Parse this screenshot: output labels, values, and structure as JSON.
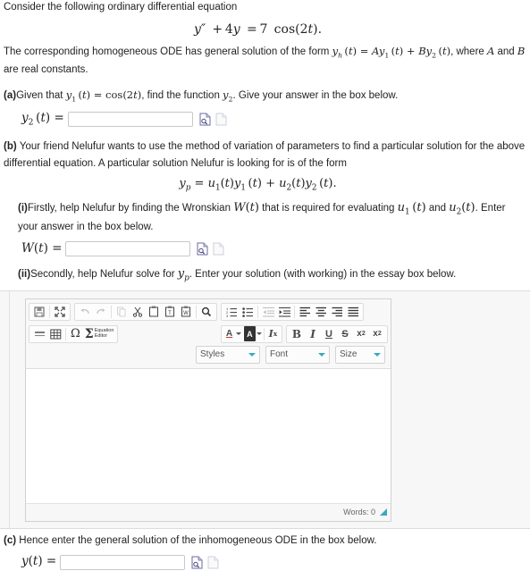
{
  "intro": {
    "line1": "Consider the following ordinary differential equation",
    "equation": "y'' + 4y = 7 cos(2t).",
    "line2_pre": "The corresponding homogeneous ODE has general solution of the form ",
    "line2_math": "y_h(t) = Ay_1(t) + By_2(t)",
    "line2_post": ", where A and B",
    "line3": "are real constants."
  },
  "part_a": {
    "label": "(a)",
    "text_pre": "Given that ",
    "given_math": "y_1(t) = cos(2t)",
    "text_mid": ", find the function ",
    "target_math": "y_2",
    "text_post": ". Give your answer in the box below.",
    "answer_label": "y_2(t) =",
    "input_value": "",
    "input_placeholder": ""
  },
  "part_b": {
    "label": "(b)",
    "text1": "Your friend Nelufur wants to use the method of variation of parameters to find a particular solution for the above",
    "text2": "differential equation. A particular solution Nelufur is looking for is of the form",
    "equation": "y_p = u_1(t)y_1(t) + u_2(t)y_2(t).",
    "sub_i": {
      "label": "(i)",
      "text_pre": "Firstly, help Nelufur by finding the Wronskian ",
      "math1": "W(t)",
      "text_mid": " that is required for evaluating ",
      "math2": "u_1(t)",
      "text_and": " and ",
      "math3": "u_2(t)",
      "text_post": ". Enter",
      "text_line2": "your answer in the box below.",
      "answer_label": "W(t) =",
      "input_value": "",
      "input_placeholder": ""
    },
    "sub_ii": {
      "label": "(ii)",
      "text_pre": "Secondly, help Nelufur solve for ",
      "math1": "y_p",
      "text_post": ". Enter your solution (with working) in the essay box below."
    }
  },
  "editor": {
    "toolbar_row1": [
      {
        "name": "save-icon",
        "glyph": "▤",
        "title": "Save",
        "disabled": false
      },
      {
        "name": "maximize-icon",
        "glyph": "⤢",
        "title": "Maximize",
        "disabled": false
      },
      {
        "name": "undo-icon",
        "glyph": "↶",
        "title": "Undo",
        "disabled": true
      },
      {
        "name": "redo-icon",
        "glyph": "↷",
        "title": "Redo",
        "disabled": true
      },
      {
        "name": "copy-icon",
        "glyph": "❐",
        "title": "Copy",
        "disabled": true
      },
      {
        "name": "cut-icon",
        "glyph": "✂",
        "title": "Cut",
        "disabled": false
      },
      {
        "name": "paste-icon",
        "glyph": "Ὄb",
        "title": "Paste",
        "disabled": false
      },
      {
        "name": "paste-text-icon",
        "glyph": "Ὄb",
        "title": "Paste as plain text",
        "disabled": false
      },
      {
        "name": "paste-word-icon",
        "glyph": "Ὄb",
        "title": "Paste from Word",
        "disabled": false
      },
      {
        "name": "search-icon",
        "glyph": "ὐd",
        "title": "Find",
        "disabled": false
      },
      {
        "name": "numbered-list-icon",
        "glyph": "≣",
        "title": "Insert/Remove Numbered List",
        "disabled": false
      },
      {
        "name": "bulleted-list-icon",
        "glyph": "≣",
        "title": "Insert/Remove Bulleted List",
        "disabled": false
      },
      {
        "name": "outdent-icon",
        "glyph": "⇤",
        "title": "Decrease Indent",
        "disabled": true
      },
      {
        "name": "indent-icon",
        "glyph": "⇥",
        "title": "Increase Indent",
        "disabled": false
      },
      {
        "name": "align-left-icon",
        "glyph": "≡",
        "title": "Align Left",
        "disabled": false
      },
      {
        "name": "align-center-icon",
        "glyph": "≡",
        "title": "Center",
        "disabled": false
      },
      {
        "name": "align-right-icon",
        "glyph": "≡",
        "title": "Align Right",
        "disabled": false
      },
      {
        "name": "justify-icon",
        "glyph": "≡",
        "title": "Justify",
        "disabled": false
      }
    ],
    "toolbar_row2_left": [
      {
        "name": "horizontal-rule-icon",
        "glyph": "—",
        "title": "Insert Horizontal Line"
      },
      {
        "name": "table-icon",
        "glyph": "⊞",
        "title": "Table"
      },
      {
        "name": "special-char-icon",
        "glyph": "Ω",
        "title": "Insert Special Character"
      }
    ],
    "equation_editor": {
      "sigma": "Σ",
      "line1": "Equation",
      "line2": "Editor"
    },
    "toolbar_row2_right_colors": [
      {
        "name": "text-color-icon",
        "glyph": "A",
        "title": "Text Color"
      },
      {
        "name": "background-color-icon",
        "glyph": "A",
        "title": "Background Color"
      },
      {
        "name": "remove-format-icon",
        "glyph": "Ix",
        "title": "Remove Format"
      }
    ],
    "toolbar_row2_right_format": [
      {
        "name": "bold-icon",
        "glyph": "B",
        "title": "Bold"
      },
      {
        "name": "italic-icon",
        "glyph": "I",
        "title": "Italic"
      },
      {
        "name": "underline-icon",
        "glyph": "U",
        "title": "Underline"
      },
      {
        "name": "strikethrough-icon",
        "glyph": "S",
        "title": "Strike Through"
      },
      {
        "name": "subscript-icon",
        "glyph": "x",
        "title": "Subscript"
      },
      {
        "name": "superscript-icon",
        "glyph": "x",
        "title": "Superscript"
      }
    ],
    "dropdowns": {
      "styles": "Styles",
      "font": "Font",
      "size": "Size"
    },
    "content": "",
    "word_count": "Words: 0"
  },
  "part_c": {
    "label": "(c)",
    "text": "Hence enter the general solution of the inhomogeneous ODE in the box below.",
    "answer_label": "y(t) =",
    "input_value": "",
    "input_placeholder": ""
  },
  "colors": {
    "accent": "#3aa8c1",
    "text": "#222222",
    "border": "#d1d1d1",
    "panel": "#f7f7f7"
  }
}
